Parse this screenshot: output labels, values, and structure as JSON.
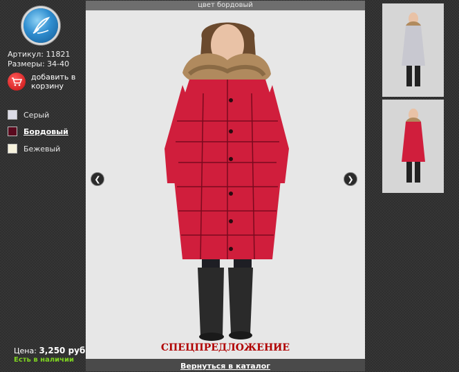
{
  "sidebar": {
    "logo_icon": "feather-pen-icon",
    "article": "Артикул: 11821",
    "sizes": "Размеры: 34-40",
    "cart": {
      "icon": "cart-icon",
      "label": "добавить в корзину"
    },
    "colors": [
      {
        "label": "Серый",
        "swatch": "#dcdce6",
        "selected": false
      },
      {
        "label": "Бордовый",
        "swatch": "#5a0a1e",
        "selected": true
      },
      {
        "label": "Бежевый",
        "swatch": "#f6f2dc",
        "selected": false
      }
    ],
    "price_label": "Цена:",
    "price_value": "3,250 руб.",
    "stock": "Есть в наличии"
  },
  "main": {
    "header": "цвет бордовый",
    "prev_icon": "chevron-left-icon",
    "next_icon": "chevron-right-icon",
    "special": "СПЕЦПРЕДЛОЖЕНИЕ",
    "back_link": "Вернуться в каталог",
    "coat_color": "#d01e3c"
  },
  "thumbnails": [
    {
      "name": "grey-coat",
      "coat_color": "#c8c8d0"
    },
    {
      "name": "burgundy-coat",
      "coat_color": "#d01e3c"
    }
  ]
}
